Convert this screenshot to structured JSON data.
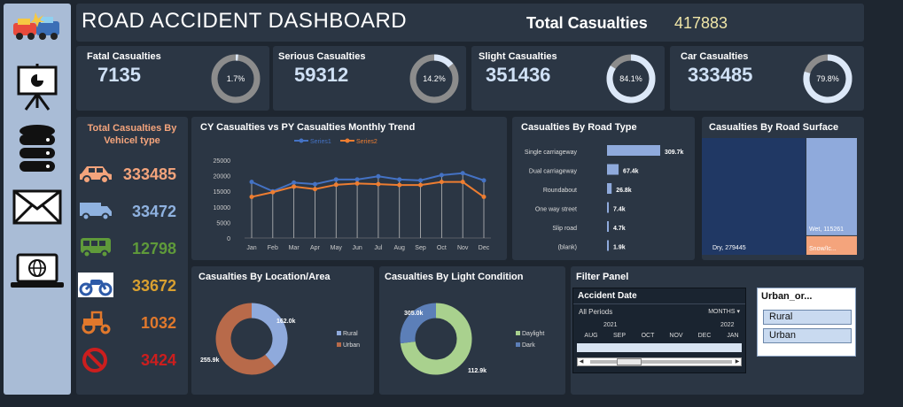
{
  "header": {
    "title": "ROAD ACCIDENT DASHBOARD",
    "total_label": "Total Casualties",
    "total_value": "417883"
  },
  "kpis": [
    {
      "label": "Fatal Casualties",
      "value": "7135",
      "pct_text": "1.7%",
      "pct": 0.017
    },
    {
      "label": "Serious Casualties",
      "value": "59312",
      "pct_text": "14.2%",
      "pct": 0.142
    },
    {
      "label": "Slight Casualties",
      "value": "351436",
      "pct_text": "84.1%",
      "pct": 0.841
    },
    {
      "label": "Car Casualties",
      "value": "333485",
      "pct_text": "79.8%",
      "pct": 0.798
    }
  ],
  "vehicle": {
    "title": "Total Casualties By Vehicel type",
    "items": [
      {
        "icon": "car-icon",
        "value": "333485",
        "color": "#f4a47c"
      },
      {
        "icon": "van-icon",
        "value": "33472",
        "color": "#8fb2e0"
      },
      {
        "icon": "bus-icon",
        "value": "12798",
        "color": "#5f9a3a"
      },
      {
        "icon": "motorcycle-icon",
        "value": "33672",
        "color": "#d9a030"
      },
      {
        "icon": "tractor-icon",
        "value": "1032",
        "color": "#e0782c"
      },
      {
        "icon": "no-entry-icon",
        "value": "3424",
        "color": "#cc1e1e"
      }
    ]
  },
  "colors": {
    "cy": "#4472c4",
    "py": "#ed7d31",
    "bar": "#8faadc",
    "dark_navy": "#203864"
  },
  "chart_data": [
    {
      "type": "line",
      "title": "CY Casualties vs PY Casualties Monthly Trend",
      "categories": [
        "Jan",
        "Feb",
        "Mar",
        "Apr",
        "May",
        "Jun",
        "Jul",
        "Aug",
        "Sep",
        "Oct",
        "Nov",
        "Dec"
      ],
      "series": [
        {
          "name": "Series1",
          "values": [
            18000,
            15000,
            17800,
            17300,
            18800,
            18800,
            19800,
            18800,
            18500,
            20200,
            20800,
            18500
          ]
        },
        {
          "name": "Series2",
          "values": [
            13200,
            14700,
            16500,
            15700,
            17100,
            17500,
            17300,
            17000,
            17000,
            18000,
            18000,
            13200
          ]
        }
      ],
      "yticks": [
        "0",
        "5000",
        "10000",
        "15000",
        "20000",
        "25000"
      ],
      "ylim": [
        0,
        25000
      ]
    },
    {
      "type": "bar",
      "title": "Casualties By Road Type",
      "categories": [
        "Single carriageway",
        "Dual carriageway",
        "Roundabout",
        "One way street",
        "Slip road",
        "(blank)"
      ],
      "values": [
        309.7,
        67.4,
        26.8,
        7.4,
        4.7,
        1.9
      ],
      "labels": [
        "309.7k",
        "67.4k",
        "26.8k",
        "7.4k",
        "4.7k",
        "1.9k"
      ]
    },
    {
      "type": "treemap",
      "title": "Casualties By Road Surface",
      "items": [
        {
          "label": "Dry, 279445",
          "value": 279445
        },
        {
          "label": "Wet, 115261",
          "value": 115261
        },
        {
          "label": "Snow/Ic...",
          "value": 23177
        }
      ]
    },
    {
      "type": "pie",
      "title": "Casualties By Location/Area",
      "labels": [
        "Rural",
        "Urban"
      ],
      "values": [
        162.0,
        255.9
      ],
      "value_labels": [
        "162.0k",
        "255.9k"
      ]
    },
    {
      "type": "pie",
      "title": "Casualties By Light Condition",
      "labels": [
        "Daylight",
        "Dark"
      ],
      "values": [
        305.0,
        112.9
      ],
      "value_labels": [
        "305.0k",
        "112.9k"
      ]
    }
  ],
  "filter": {
    "title": "Filter Panel",
    "date_title": "Accident Date",
    "all_periods": "All Periods",
    "months_label": "MONTHS ▾",
    "year1": "2021",
    "year2": "2022",
    "months": [
      "AUG",
      "SEP",
      "OCT",
      "NOV",
      "DEC",
      "JAN"
    ],
    "urban_title": "Urban_or...",
    "urban_items": [
      "Rural",
      "Urban"
    ]
  }
}
